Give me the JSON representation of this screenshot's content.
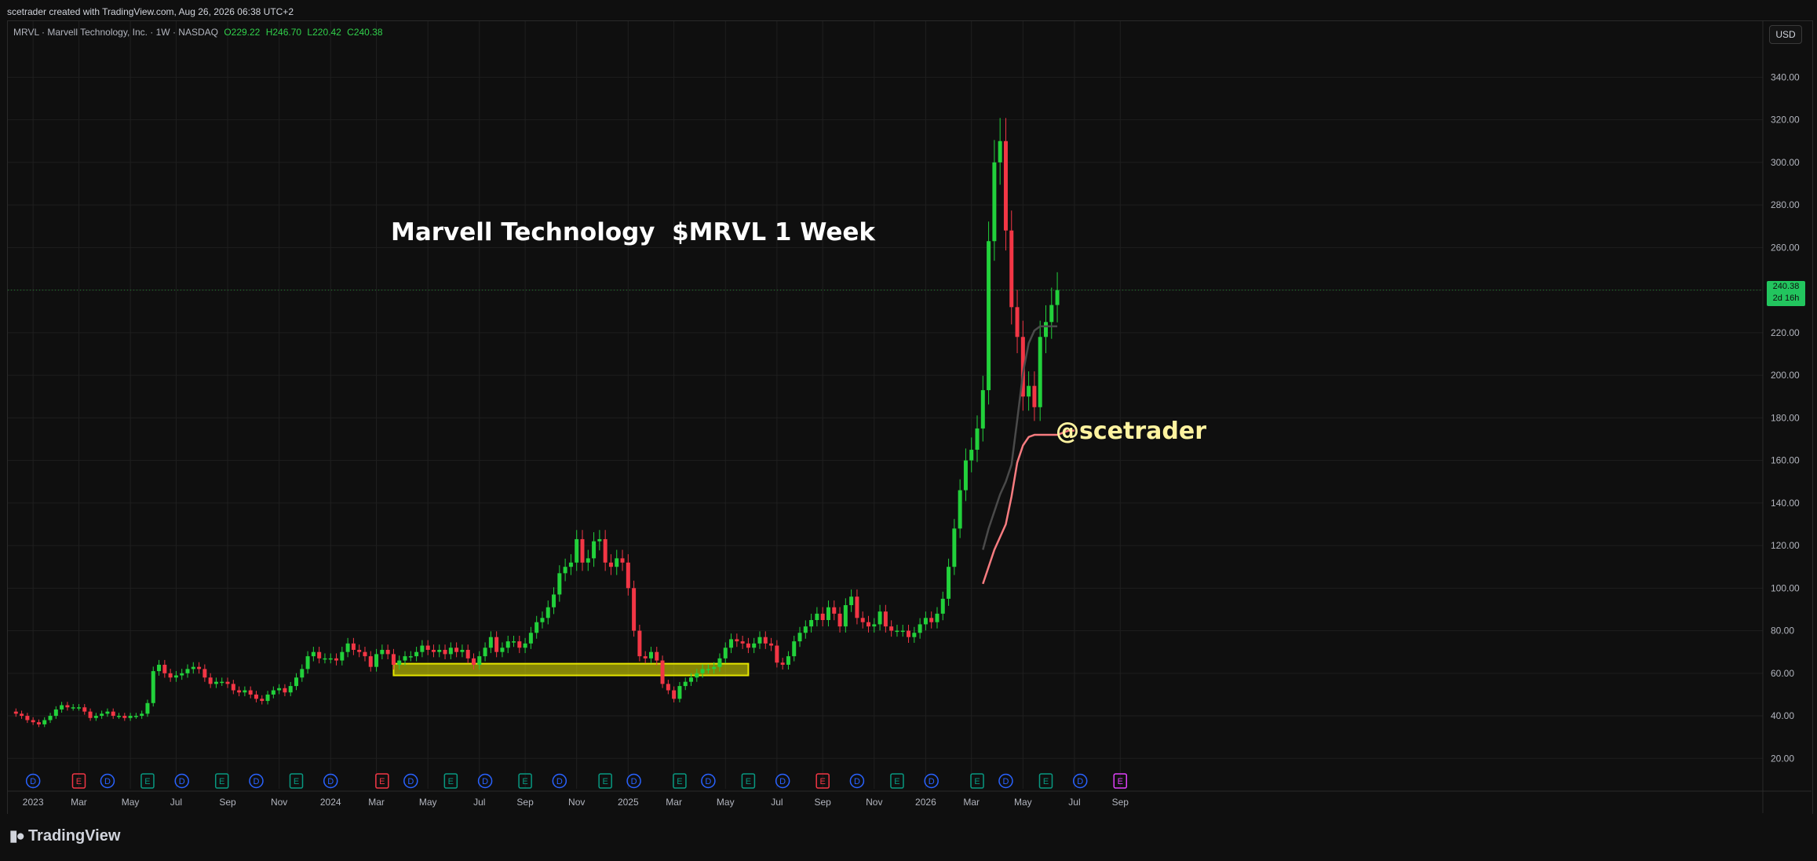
{
  "header": {
    "created_by": "scetrader created with TradingView.com, Aug 26, 2026 06:38 UTC+2"
  },
  "legend": {
    "symbol": "MRVL · Marvell Technology, Inc. · 1W · NASDAQ",
    "open": "O229.22",
    "high": "H246.70",
    "low": "L220.42",
    "close": "C240.38"
  },
  "currency_button": "USD",
  "price_label": {
    "price": "240.38",
    "countdown": "2d 16h"
  },
  "brand": {
    "logo_text": "TradingView"
  },
  "colors": {
    "up": "#22d13b",
    "down": "#f23645",
    "background": "#0f0f0f",
    "ma_slow": "#f77c80",
    "ma_fast": "#4a4a4a",
    "zone": "#e6e600",
    "text_title": "#ffffff",
    "text_handle": "#fff3a0"
  },
  "chart_data": {
    "type": "candlestick",
    "title": "Marvell Technology  $MRVL 1 Week",
    "annotation": "@scetrader",
    "ylim": [
      20,
      340
    ],
    "y_ticks": [
      "340.00",
      "320.00",
      "300.00",
      "280.00",
      "260.00",
      "240.00",
      "220.00",
      "200.00",
      "180.00",
      "160.00",
      "140.00",
      "120.00",
      "100.00",
      "80.00",
      "60.00",
      "40.00",
      "20.00"
    ],
    "x_ticks": [
      {
        "label": "2023",
        "week": 4
      },
      {
        "label": "Mar",
        "week": 12
      },
      {
        "label": "May",
        "week": 21
      },
      {
        "label": "Jul",
        "week": 29
      },
      {
        "label": "Sep",
        "week": 38
      },
      {
        "label": "Nov",
        "week": 47
      },
      {
        "label": "2024",
        "week": 56
      },
      {
        "label": "Mar",
        "week": 64
      },
      {
        "label": "May",
        "week": 73
      },
      {
        "label": "Jul",
        "week": 82
      },
      {
        "label": "Sep",
        "week": 90
      },
      {
        "label": "Nov",
        "week": 99
      },
      {
        "label": "2025",
        "week": 108
      },
      {
        "label": "Mar",
        "week": 116
      },
      {
        "label": "May",
        "week": 125
      },
      {
        "label": "Jul",
        "week": 134
      },
      {
        "label": "Sep",
        "week": 142
      },
      {
        "label": "Nov",
        "week": 151
      },
      {
        "label": "2026",
        "week": 160
      },
      {
        "label": "Mar",
        "week": 168
      },
      {
        "label": "May",
        "week": 177
      },
      {
        "label": "Jul",
        "week": 186
      },
      {
        "label": "Sep",
        "week": 194
      }
    ],
    "support_zone": {
      "low": 59.0,
      "high": 64.5,
      "start_week": 67,
      "end_week": 129
    },
    "events": [
      {
        "week": 4,
        "type": "D",
        "color": "#2962ff"
      },
      {
        "week": 12,
        "type": "E",
        "color": "#f23645"
      },
      {
        "week": 17,
        "type": "D",
        "color": "#2962ff"
      },
      {
        "week": 24,
        "type": "E",
        "color": "#089981"
      },
      {
        "week": 30,
        "type": "D",
        "color": "#2962ff"
      },
      {
        "week": 37,
        "type": "E",
        "color": "#089981"
      },
      {
        "week": 43,
        "type": "D",
        "color": "#2962ff"
      },
      {
        "week": 50,
        "type": "E",
        "color": "#089981"
      },
      {
        "week": 56,
        "type": "D",
        "color": "#2962ff"
      },
      {
        "week": 65,
        "type": "E",
        "color": "#f23645"
      },
      {
        "week": 70,
        "type": "D",
        "color": "#2962ff"
      },
      {
        "week": 77,
        "type": "E",
        "color": "#089981"
      },
      {
        "week": 83,
        "type": "D",
        "color": "#2962ff"
      },
      {
        "week": 90,
        "type": "E",
        "color": "#089981"
      },
      {
        "week": 96,
        "type": "D",
        "color": "#2962ff"
      },
      {
        "week": 104,
        "type": "E",
        "color": "#089981"
      },
      {
        "week": 109,
        "type": "D",
        "color": "#2962ff"
      },
      {
        "week": 117,
        "type": "E",
        "color": "#089981"
      },
      {
        "week": 122,
        "type": "D",
        "color": "#2962ff"
      },
      {
        "week": 129,
        "type": "E",
        "color": "#089981"
      },
      {
        "week": 135,
        "type": "D",
        "color": "#2962ff"
      },
      {
        "week": 142,
        "type": "E",
        "color": "#f23645"
      },
      {
        "week": 148,
        "type": "D",
        "color": "#2962ff"
      },
      {
        "week": 155,
        "type": "E",
        "color": "#089981"
      },
      {
        "week": 161,
        "type": "D",
        "color": "#2962ff"
      },
      {
        "week": 169,
        "type": "E",
        "color": "#089981"
      },
      {
        "week": 174,
        "type": "D",
        "color": "#2962ff"
      },
      {
        "week": 181,
        "type": "E",
        "color": "#089981"
      },
      {
        "week": 187,
        "type": "D",
        "color": "#2962ff"
      },
      {
        "week": 194,
        "type": "E",
        "color": "#e040fb"
      }
    ],
    "closes": [
      41,
      40,
      38,
      37,
      36,
      38,
      40,
      43,
      45,
      44,
      44,
      44,
      42,
      39,
      40,
      41,
      42,
      40,
      40,
      39,
      40,
      40,
      41,
      46,
      61,
      64,
      60,
      58,
      59,
      60,
      62,
      63,
      62,
      58,
      55,
      56,
      56,
      55,
      52,
      51,
      52,
      50,
      48,
      47,
      50,
      52,
      53,
      51,
      54,
      58,
      62,
      68,
      70,
      67,
      67,
      67,
      66,
      70,
      74,
      71,
      70,
      68,
      63,
      69,
      71,
      69,
      64,
      66,
      68,
      68,
      70,
      73,
      71,
      70,
      71,
      69,
      72,
      70,
      71,
      67,
      64,
      68,
      72,
      77,
      70,
      72,
      75,
      75,
      72,
      74,
      79,
      84,
      86,
      91,
      97,
      107,
      110,
      112,
      123,
      112,
      114,
      122,
      123,
      112,
      110,
      114,
      112,
      100,
      80,
      68,
      67,
      70,
      66,
      55,
      52,
      48,
      54,
      56,
      58,
      60,
      62,
      62,
      63,
      67,
      72,
      76,
      75,
      74,
      72,
      74,
      77,
      74,
      73,
      65,
      64,
      68,
      75,
      79,
      82,
      85,
      88,
      85,
      91,
      88,
      82,
      92,
      96,
      86,
      84,
      82,
      83,
      89,
      82,
      80,
      80,
      80,
      77,
      79,
      83,
      86,
      84,
      88,
      95,
      110,
      128,
      146,
      160,
      165,
      175,
      193,
      263,
      300,
      310,
      268,
      232,
      218,
      190,
      195,
      185,
      218,
      225,
      233,
      240
    ],
    "ma_slow_start_week": 170,
    "ma_slow": [
      102,
      110,
      118,
      124,
      130,
      143,
      159,
      167,
      171,
      172,
      172,
      172,
      172,
      172,
      173,
      174,
      174
    ],
    "ma_fast_start_week": 170,
    "ma_fast": [
      118,
      128,
      136,
      144,
      150,
      158,
      179,
      201,
      215,
      221,
      223,
      223,
      223,
      223
    ]
  }
}
